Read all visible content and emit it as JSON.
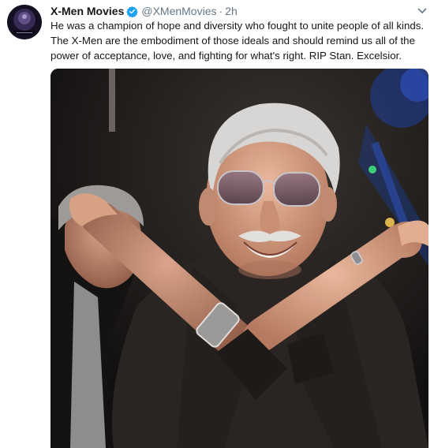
{
  "tweet": {
    "author_name": "X-Men Movies",
    "handle": "@XMenMovies",
    "separator": "·",
    "timestamp": "2h",
    "text_lines": [
      "He was a champion of hope and diversity who fought to unite people of all kinds.",
      "The X-Men are the embodiment of those ideals and should remind us all of the",
      "power of acceptance, love, and fighting for what's right. RIP Stan. Excelsior."
    ],
    "icons": {
      "avatar": "xmen-avatar-icon",
      "verified": "verified-badge-icon",
      "menu": "chevron-down-icon"
    },
    "colors": {
      "name": "#14171a",
      "secondary": "#657786",
      "verified": "#1da1f2"
    }
  }
}
